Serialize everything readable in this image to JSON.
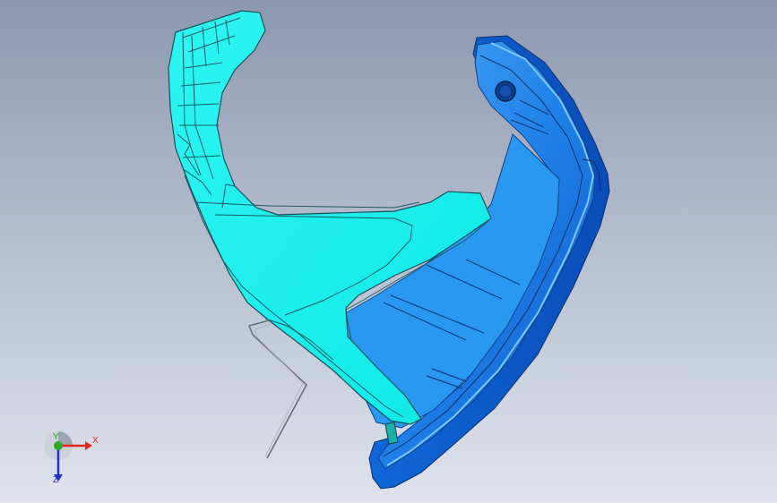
{
  "viewport": {
    "background_top": "#8c98ae",
    "background_bottom": "#dfe4ec"
  },
  "model": {
    "light_part_color": "#12f2ee",
    "dark_part_color": "#1e7fe6",
    "edge_color": "#1a2a3a"
  },
  "triad": {
    "x_label": "X",
    "y_label": "Y",
    "z_label": "Z",
    "x_color": "#e0281e",
    "y_color": "#2ea82e",
    "z_color": "#2430c8"
  }
}
